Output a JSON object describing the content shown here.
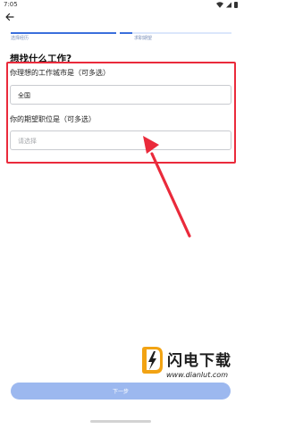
{
  "status_bar": {
    "time": "7:05",
    "icons": [
      "wifi-icon",
      "signal-icon",
      "battery-icon"
    ]
  },
  "nav": {
    "back_icon": "back-arrow-icon"
  },
  "progress": {
    "step_1_label": "选择经历",
    "step_2_label": "求职期望",
    "current_step": 2
  },
  "page": {
    "title": "想找什么工作?"
  },
  "form": {
    "city_label": "你理想的工作城市是（可多选）",
    "city_value": "全国",
    "position_label": "你的期望职位是（可多选）",
    "position_placeholder": "请选择"
  },
  "footer": {
    "next_label": "下一步"
  },
  "watermark": {
    "name": "闪电下载",
    "url": "www.dianlut.com"
  },
  "colors": {
    "accent": "#3b6fdc",
    "button": "#9cb8ef",
    "highlight": "#ea2a3b"
  }
}
